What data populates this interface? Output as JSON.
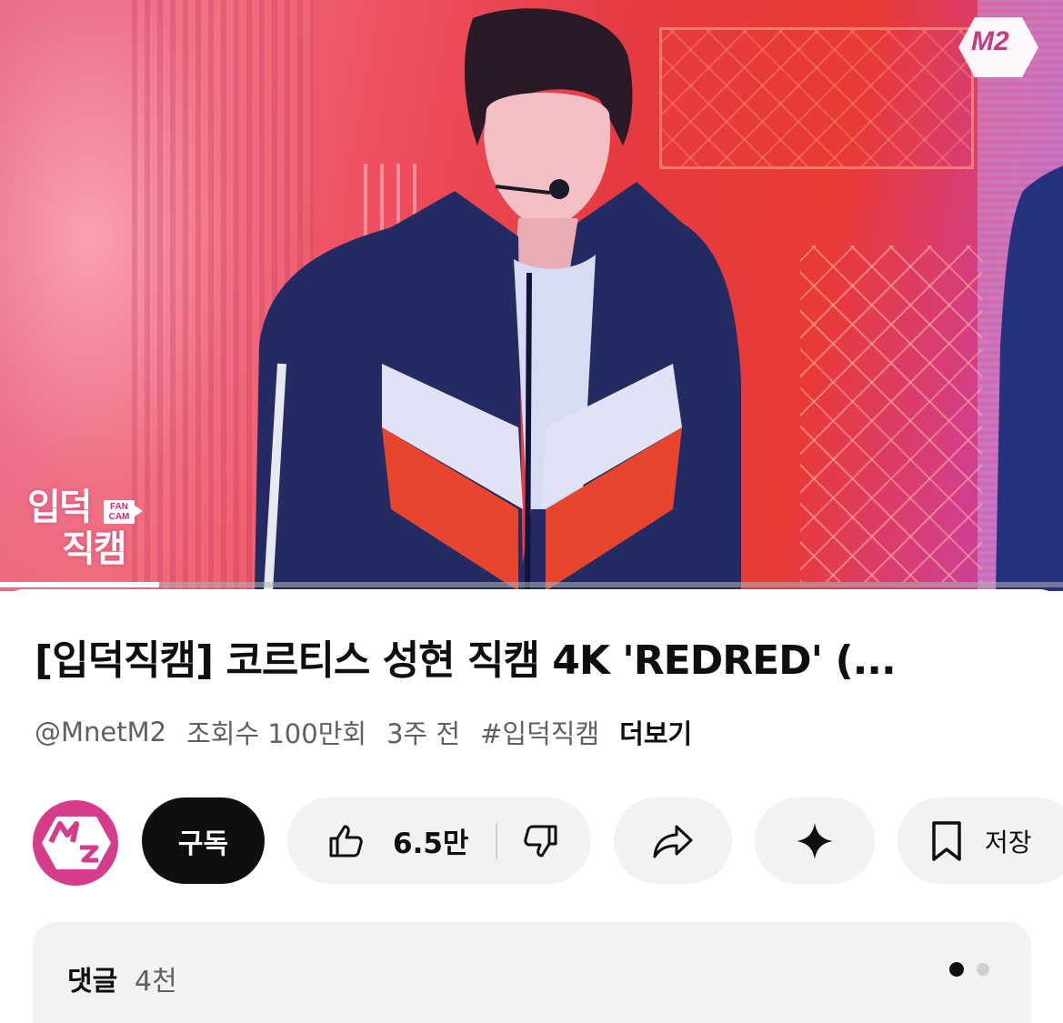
{
  "video": {
    "channel_logo_text": "M2",
    "overlay_badge": {
      "line1": "입덕",
      "line2": "직캠",
      "tag_line1": "FAN",
      "tag_line2": "CAM"
    },
    "progress_fraction": 0.15
  },
  "title": "[입덕직캠] 코르티스 성현 직캠 4K 'REDRED' (...",
  "meta": {
    "channel": "@MnetM2",
    "views": "조회수 100만회",
    "age": "3주 전",
    "hashtag": "#입덕직캠",
    "more": "더보기"
  },
  "actions": {
    "subscribe_label": "구독",
    "like_count": "6.5만",
    "save_label": "저장",
    "icons": {
      "like": "thumbs-up-icon",
      "dislike": "thumbs-down-icon",
      "share": "share-icon",
      "ai": "sparkle-icon",
      "save": "bookmark-icon"
    }
  },
  "comments": {
    "label": "댓글",
    "count": "4천"
  },
  "colors": {
    "brand_pink": "#d63c8a",
    "subscribe_bg": "#0f0f0f",
    "chip_bg": "#f2f2f2"
  }
}
